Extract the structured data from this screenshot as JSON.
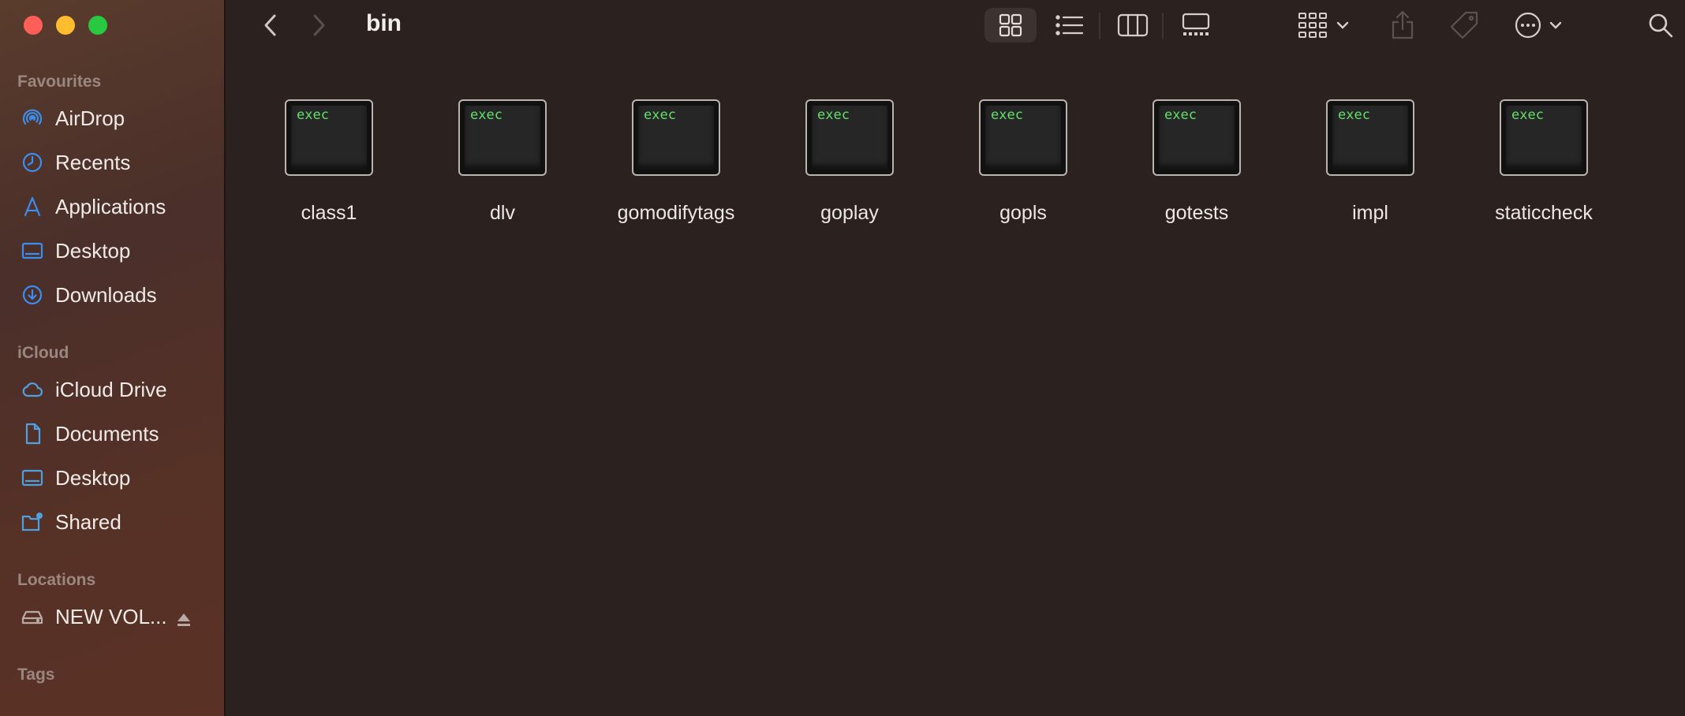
{
  "window": {
    "title": "bin"
  },
  "sidebar": {
    "favourites_title": "Favourites",
    "favourites": [
      {
        "label": "AirDrop",
        "icon": "airdrop-icon"
      },
      {
        "label": "Recents",
        "icon": "clock-icon"
      },
      {
        "label": "Applications",
        "icon": "applications-icon"
      },
      {
        "label": "Desktop",
        "icon": "desktop-icon"
      },
      {
        "label": "Downloads",
        "icon": "downloads-icon"
      }
    ],
    "icloud_title": "iCloud",
    "icloud": [
      {
        "label": "iCloud Drive",
        "icon": "cloud-icon"
      },
      {
        "label": "Documents",
        "icon": "document-icon"
      },
      {
        "label": "Desktop",
        "icon": "desktop-icon"
      },
      {
        "label": "Shared",
        "icon": "shared-folder-icon"
      }
    ],
    "locations_title": "Locations",
    "locations": [
      {
        "label": "NEW VOL...",
        "icon": "drive-icon"
      }
    ],
    "tags_title": "Tags"
  },
  "files": [
    {
      "name": "class1",
      "badge": "exec"
    },
    {
      "name": "dlv",
      "badge": "exec"
    },
    {
      "name": "gomodifytags",
      "badge": "exec"
    },
    {
      "name": "goplay",
      "badge": "exec"
    },
    {
      "name": "gopls",
      "badge": "exec"
    },
    {
      "name": "gotests",
      "badge": "exec"
    },
    {
      "name": "impl",
      "badge": "exec"
    },
    {
      "name": "staticcheck",
      "badge": "exec"
    }
  ],
  "colors": {
    "accent": "#3b8ef0",
    "exec_text": "#62e06a",
    "sidebar_icon": "#3b8ef0"
  }
}
